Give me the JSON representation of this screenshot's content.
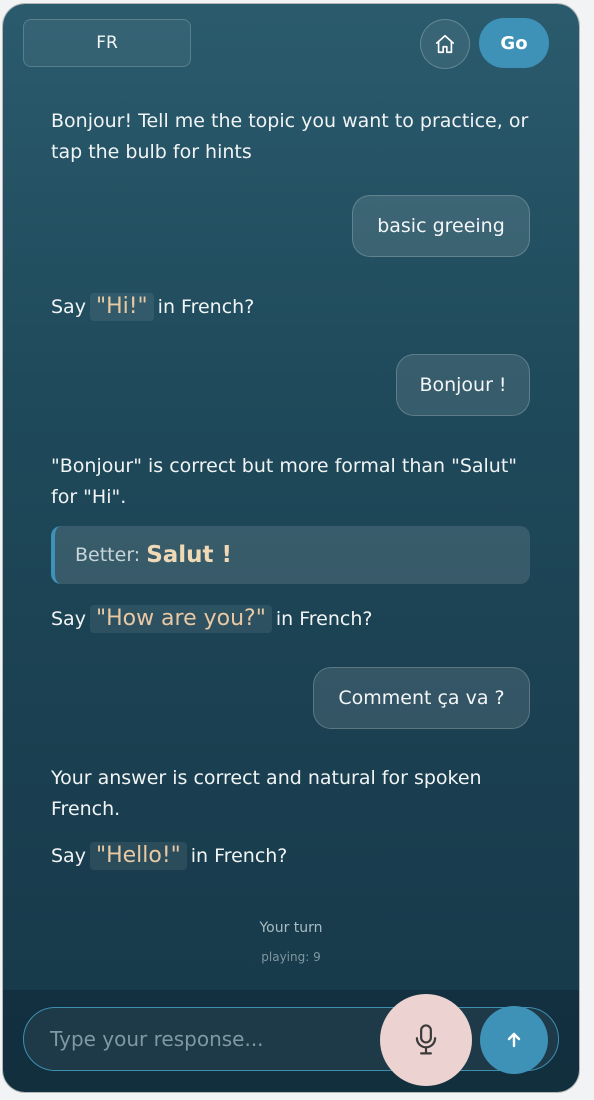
{
  "header": {
    "language_label": "FR",
    "go_label": "Go",
    "home_icon": "home-icon"
  },
  "chat": {
    "intro": "Bonjour! Tell me the topic you want to practice, or tap the bulb for hints",
    "user_topic": "basic greeing",
    "prompt1": {
      "before": "Say",
      "phrase": "\"Hi!\"",
      "after": "in French?"
    },
    "user_answer1": "Bonjour !",
    "feedback1": "\"Bonjour\" is correct but more formal than \"Salut\" for \"Hi\".",
    "better_label": "Better:",
    "better_value": "Salut !",
    "prompt2": {
      "before": "Say",
      "phrase": "\"How are you?\"",
      "after": "in French?"
    },
    "user_answer2": "Comment ça va ?",
    "feedback2": "Your answer is correct and natural for spoken French.",
    "prompt3": {
      "before": "Say",
      "phrase": "\"Hello!\"",
      "after": "in French?"
    }
  },
  "status": {
    "turn": "Your turn",
    "playing": "playing: 9"
  },
  "footer": {
    "input_placeholder": "Type your response...",
    "mic_icon": "microphone-icon",
    "send_icon": "arrow-up-icon"
  },
  "colors": {
    "accent": "#3e92b8",
    "phrase": "#e9c9a4",
    "mic_bg": "#ecd2d0"
  }
}
